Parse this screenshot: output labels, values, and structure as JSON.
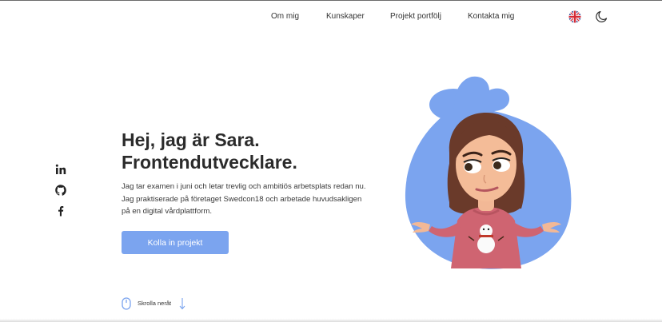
{
  "nav": {
    "links": [
      "Om mig",
      "Kunskaper",
      "Projekt portfölj",
      "Kontakta mig"
    ],
    "language_icon": "uk-flag-icon",
    "theme_icon": "moon-icon"
  },
  "social": {
    "icons": [
      "linkedin-icon",
      "github-icon",
      "facebook-icon"
    ]
  },
  "hero": {
    "title_line1": "Hej, jag är Sara.",
    "title_line2": "Frontendutvecklare.",
    "description": "Jag tar examen i juni och letar trevlig och ambitiös arbetsplats redan nu. Jag praktiserade på företaget Swedcon18 och arbetade huvudsakligen på en digital vårdplattform.",
    "cta_label": "Kolla in projekt"
  },
  "scroll": {
    "label": "Skrolla neråt"
  },
  "colors": {
    "accent": "#7ba4ef",
    "text": "#2b2b2b"
  }
}
